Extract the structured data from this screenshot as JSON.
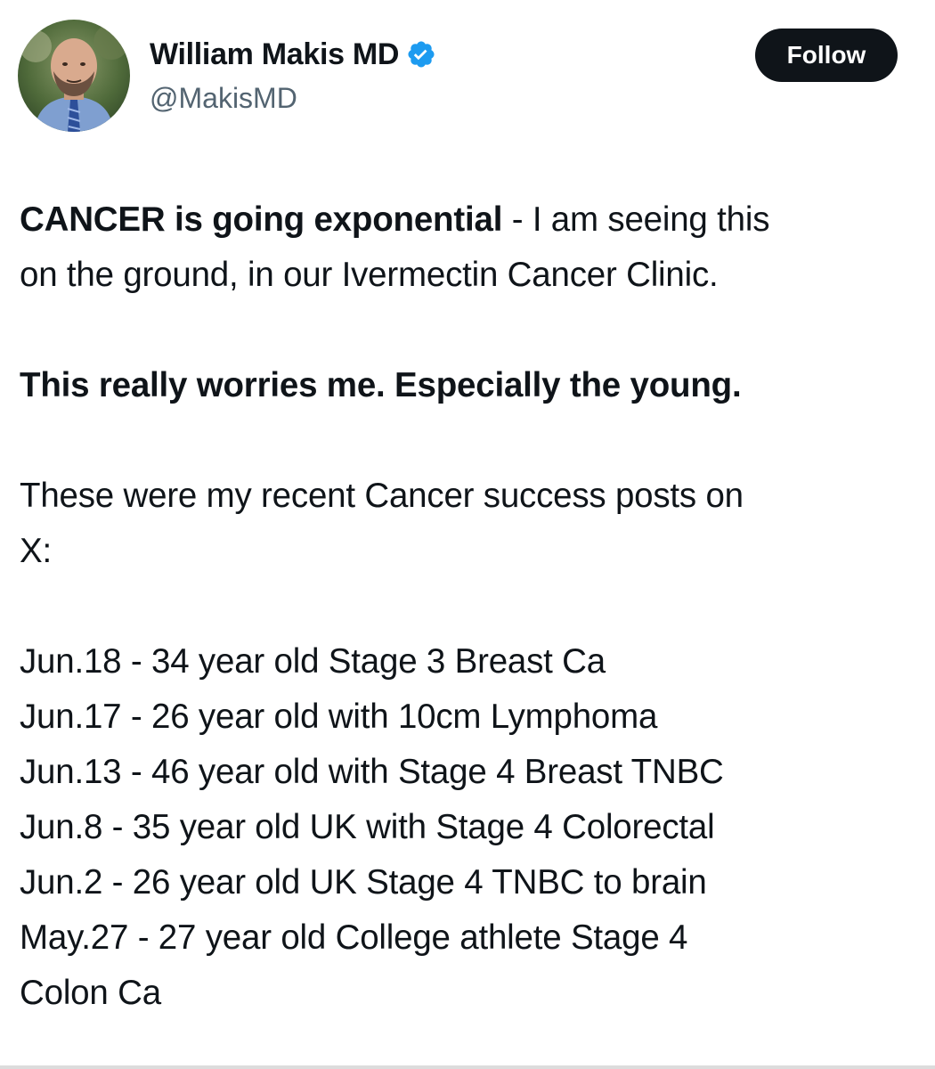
{
  "author": {
    "display_name": "William Makis MD",
    "handle": "@MakisMD",
    "verified_icon": "verified-badge-icon",
    "verified_color": "#1d9bf0"
  },
  "follow_label": "Follow",
  "post": {
    "p1_bold": "CANCER is going exponential",
    "p1_rest_line1": " - I am seeing this",
    "p1_line2": "on the ground, in our Ivermectin Cancer Clinic.",
    "p2_bold": "This really worries me. Especially the young.",
    "p3_line1": "These were my recent Cancer success posts on",
    "p3_line2": "X:",
    "list": [
      "Jun.18 - 34 year old Stage 3 Breast Ca",
      "Jun.17 - 26 year old with 10cm Lymphoma",
      "Jun.13 - 46 year old with Stage 4 Breast TNBC",
      "Jun.8 - 35 year old UK with Stage 4 Colorectal",
      "Jun.2 - 26 year old UK Stage 4 TNBC to brain",
      "May.27 - 27 year old College athlete Stage 4",
      "Colon Ca"
    ]
  },
  "colors": {
    "text": "#0f1419",
    "secondary": "#536471",
    "button_bg": "#0f1419",
    "button_text": "#ffffff"
  }
}
